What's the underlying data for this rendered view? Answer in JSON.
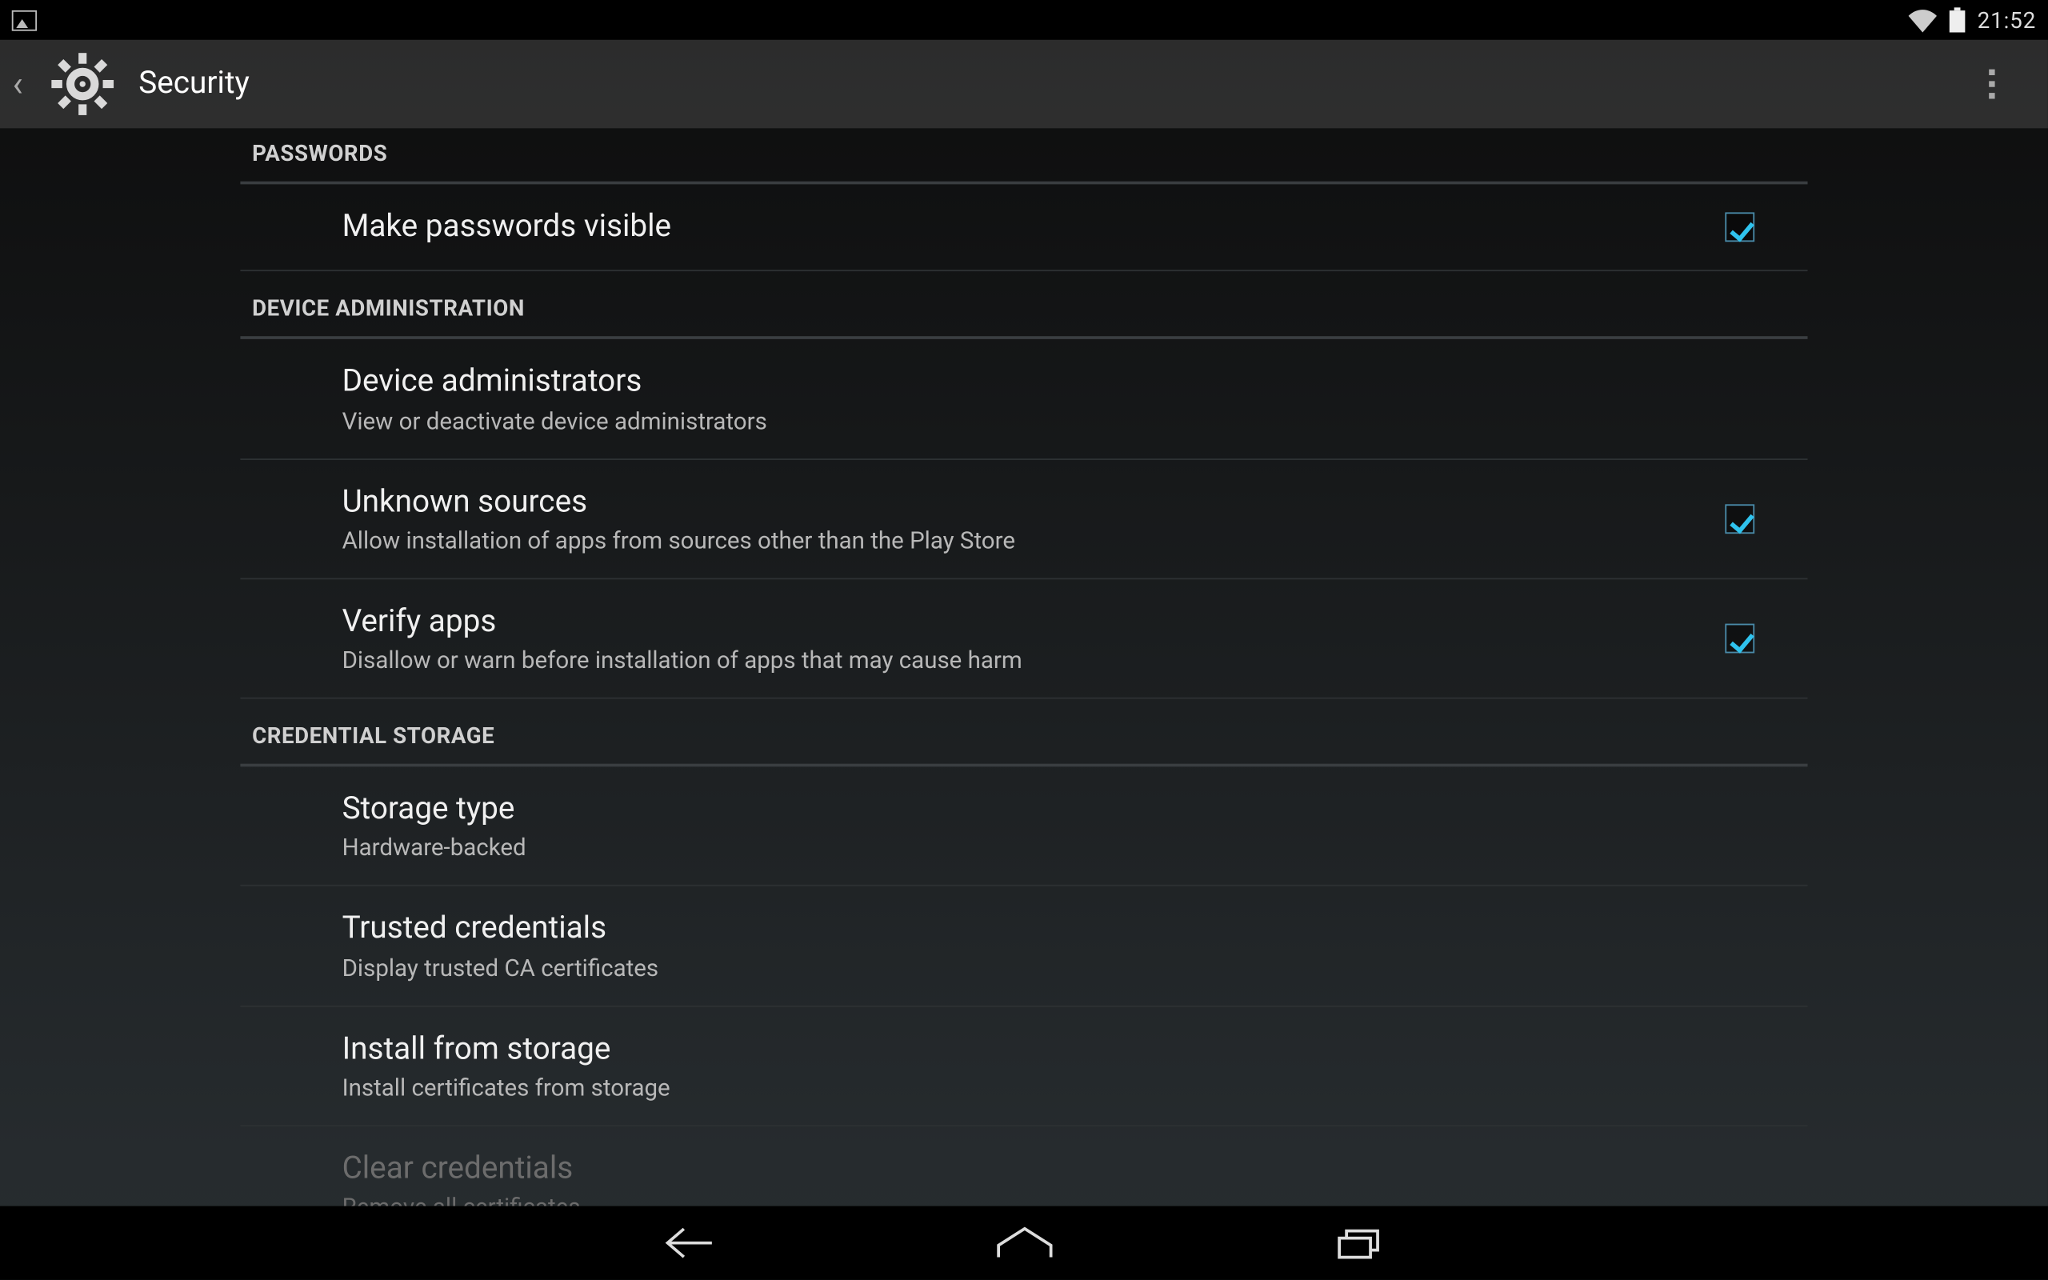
{
  "status": {
    "time": "21:52"
  },
  "actionbar": {
    "title": "Security"
  },
  "sections": [
    {
      "header": "PASSWORDS",
      "items": [
        {
          "title": "Make passwords visible",
          "subtitle": null,
          "checkbox": true,
          "checked": true,
          "disabled": false
        }
      ]
    },
    {
      "header": "DEVICE ADMINISTRATION",
      "items": [
        {
          "title": "Device administrators",
          "subtitle": "View or deactivate device administrators",
          "checkbox": false,
          "checked": false,
          "disabled": false
        },
        {
          "title": "Unknown sources",
          "subtitle": "Allow installation of apps from sources other than the Play Store",
          "checkbox": true,
          "checked": true,
          "disabled": false
        },
        {
          "title": "Verify apps",
          "subtitle": "Disallow or warn before installation of apps that may cause harm",
          "checkbox": true,
          "checked": true,
          "disabled": false
        }
      ]
    },
    {
      "header": "CREDENTIAL STORAGE",
      "items": [
        {
          "title": "Storage type",
          "subtitle": "Hardware-backed",
          "checkbox": false,
          "checked": false,
          "disabled": false
        },
        {
          "title": "Trusted credentials",
          "subtitle": "Display trusted CA certificates",
          "checkbox": false,
          "checked": false,
          "disabled": false
        },
        {
          "title": "Install from storage",
          "subtitle": "Install certificates from storage",
          "checkbox": false,
          "checked": false,
          "disabled": false
        },
        {
          "title": "Clear credentials",
          "subtitle": "Remove all certificates",
          "checkbox": false,
          "checked": false,
          "disabled": true
        }
      ]
    }
  ]
}
